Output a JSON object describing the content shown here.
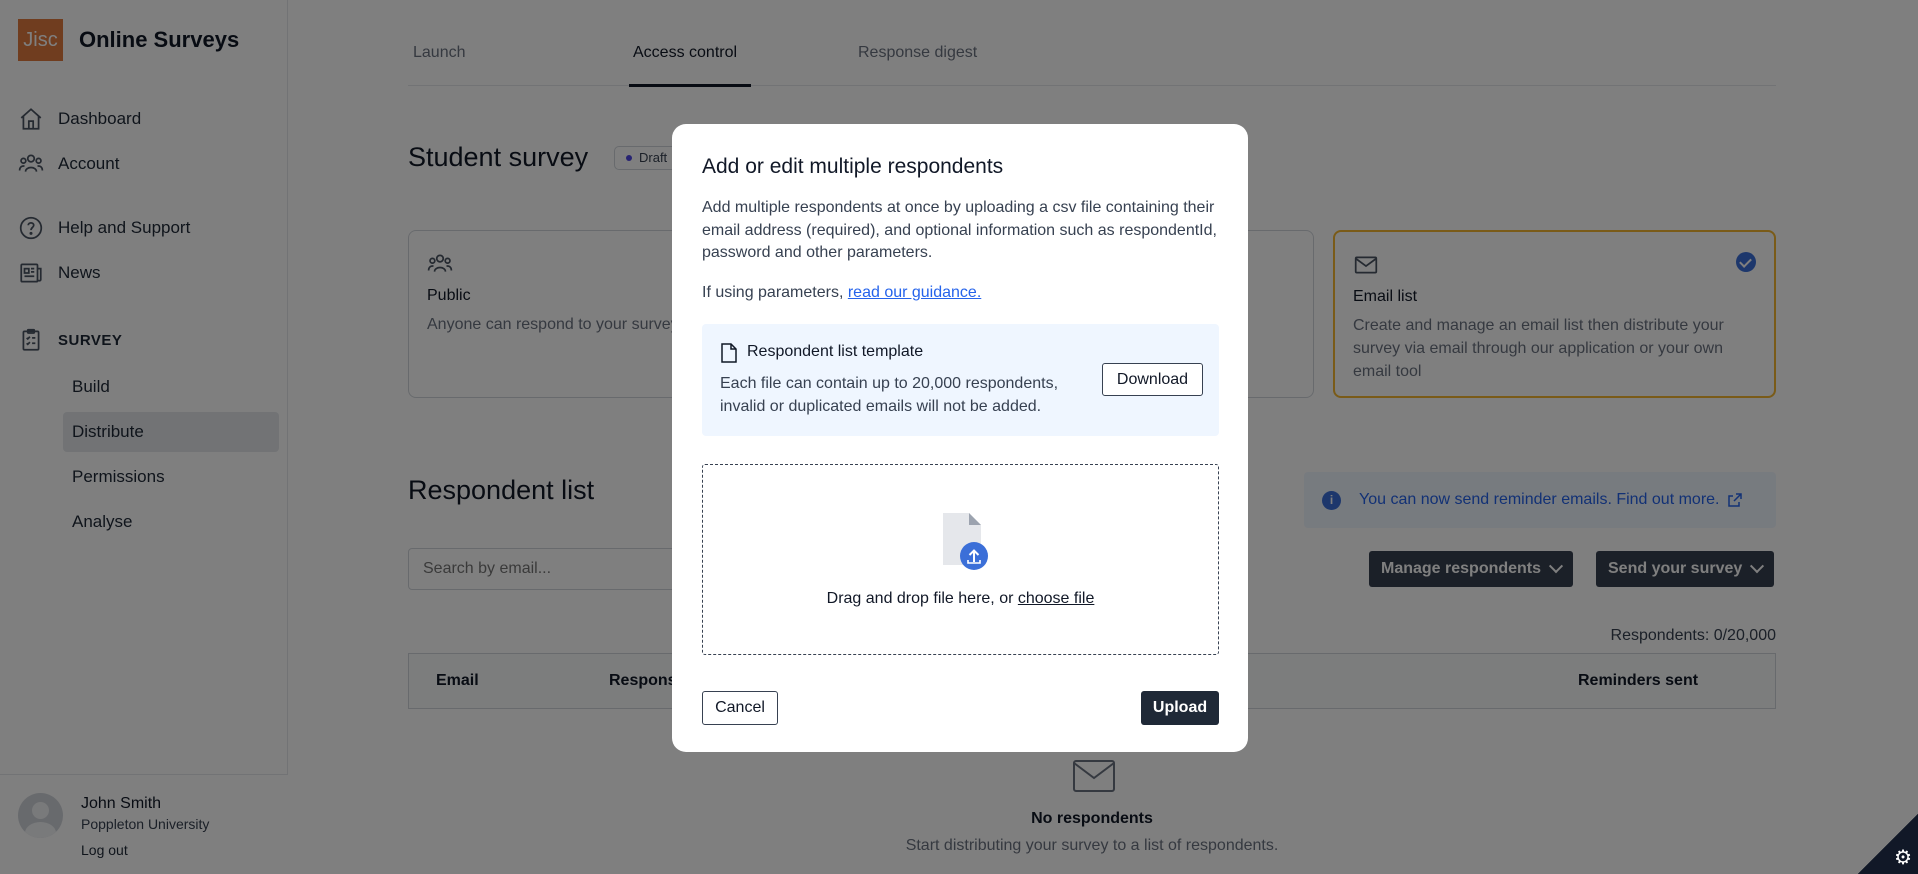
{
  "sidebar": {
    "logo": "Jisc",
    "app_name": "Online Surveys",
    "nav": {
      "dashboard": "Dashboard",
      "account": "Account",
      "help": "Help and Support",
      "news": "News"
    },
    "section": "SURVEY",
    "sub_items": {
      "build": "Build",
      "distribute": "Distribute",
      "permissions": "Permissions",
      "analyse": "Analyse"
    },
    "user": {
      "name": "John Smith",
      "org": "Poppleton University",
      "logout": "Log out"
    }
  },
  "tabs": {
    "launch": "Launch",
    "access_control": "Access control",
    "response_digest": "Response digest"
  },
  "survey": {
    "title": "Student survey",
    "status": "Draft"
  },
  "cards": {
    "public": {
      "title": "Public",
      "desc": "Anyone can respond to your survey with the url"
    },
    "email": {
      "title": "Email list",
      "desc": "Create and manage an email list then distribute your survey via email through our application or your own email tool"
    }
  },
  "respondents": {
    "title": "Respondent list",
    "banner": "You can now send reminder emails. Find out more.",
    "search_placeholder": "Search by email...",
    "manage_button": "Manage respondents",
    "send_button": "Send your survey",
    "count": "Respondents: 0/20,000",
    "columns": {
      "email": "Email",
      "respondent": "Respons",
      "reminders": "Reminders sent"
    },
    "empty_title": "No respondents",
    "empty_sub": "Start distributing your survey to a list of respondents."
  },
  "modal": {
    "title": "Add or edit multiple respondents",
    "desc": "Add multiple respondents at once by uploading a csv file containing their email address (required), and optional information such as respondentId, password and other parameters.",
    "params_prefix": "If using parameters, ",
    "params_link": "read our guidance.",
    "template_title": "Respondent list template",
    "template_desc": "Each file can contain up to 20,000 respondents, invalid or duplicated emails will not be added.",
    "download": "Download",
    "drop_prefix": "Drag and drop file here, or ",
    "drop_link": "choose file",
    "cancel": "Cancel",
    "upload": "Upload"
  },
  "colors": {
    "brand": "#e07a3f",
    "accent": "#3b6fd8",
    "selected_card": "#f5b731",
    "dark_button": "#374151"
  }
}
